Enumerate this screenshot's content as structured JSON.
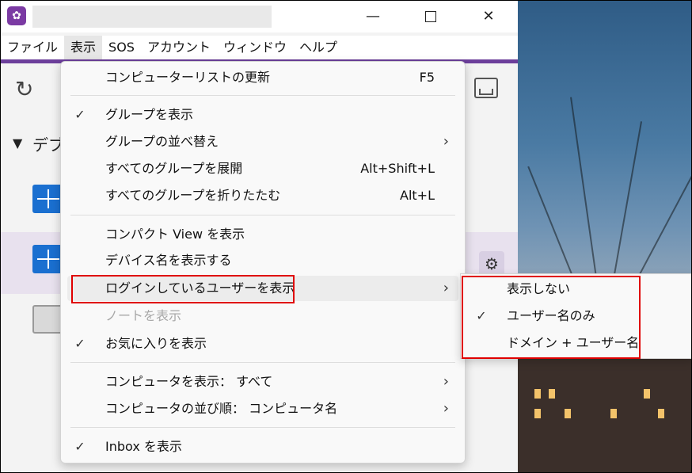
{
  "menubar": {
    "items": [
      "ファイル",
      "表示",
      "SOS",
      "アカウント",
      "ウィンドウ",
      "ヘルプ"
    ]
  },
  "sidebar": {
    "group_label": "デブ",
    "group_toggle": "▼"
  },
  "icons": {
    "refresh": "refresh-icon",
    "inbox": "inbox-icon",
    "gear": "gear-icon",
    "check": "checkmark-icon",
    "chevron": "chevron-right-icon"
  },
  "view_menu": {
    "items": [
      {
        "label": "コンピューターリストの更新",
        "shortcut": "F5"
      },
      {
        "label": "グループを表示",
        "checked": true
      },
      {
        "label": "グループの並べ替え",
        "submenu": true
      },
      {
        "label": "すべてのグループを展開",
        "shortcut": "Alt+Shift+L"
      },
      {
        "label": "すべてのグループを折りたたむ",
        "shortcut": "Alt+L"
      },
      {
        "label": "コンパクト View を表示"
      },
      {
        "label": "デバイス名を表示する"
      },
      {
        "label": "ログインしているユーザーを表示",
        "submenu": true,
        "highlighted": true
      },
      {
        "label": "ノートを表示",
        "disabled": true
      },
      {
        "label": "お気に入りを表示",
        "checked": true
      },
      {
        "label": "コンピュータを表示： すべて",
        "submenu": true
      },
      {
        "label": "コンピュータの並び順： コンピュータ名",
        "submenu": true
      },
      {
        "label": "Inbox を表示",
        "checked": true
      }
    ],
    "check_glyph": "✓",
    "arrow_glyph": "›"
  },
  "logged_in_user_submenu": {
    "items": [
      {
        "label": "表示しない",
        "checked": false
      },
      {
        "label": "ユーザー名のみ",
        "checked": true
      },
      {
        "label": "ドメイン + ユーザー名",
        "checked": false
      }
    ]
  },
  "colors": {
    "accent": "#6c3f9b",
    "highlight_box": "#e00000"
  }
}
